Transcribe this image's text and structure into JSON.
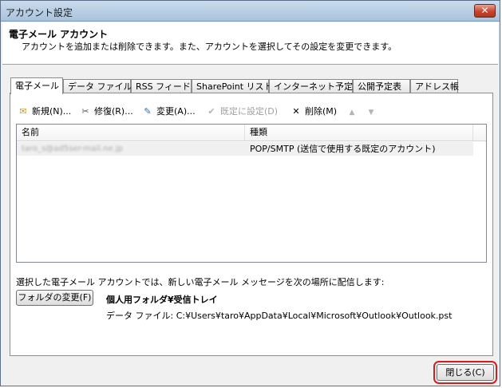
{
  "window": {
    "title": "アカウント設定",
    "close_glyph": "✕"
  },
  "header": {
    "title": "電子メール アカウント",
    "description": "アカウントを追加または削除できます。また、アカウントを選択してその設定を変更できます。"
  },
  "tabs": [
    {
      "label": "電子メール",
      "active": true
    },
    {
      "label": "データ ファイル"
    },
    {
      "label": "RSS フィード"
    },
    {
      "label": "SharePoint リスト"
    },
    {
      "label": "インターネット予定表"
    },
    {
      "label": "公開予定表"
    },
    {
      "label": "アドレス帳"
    }
  ],
  "toolbar": {
    "new_label": "新規(N)...",
    "repair_label": "修復(R)...",
    "change_label": "変更(A)...",
    "default_label": "既定に設定(D)",
    "delete_label": "削除(M)",
    "icons": {
      "new": "✉",
      "repair": "✂",
      "change": "✎",
      "default": "✔",
      "delete": "✕",
      "up": "▲",
      "down": "▼"
    }
  },
  "accounts_table": {
    "columns": [
      "名前",
      "種類"
    ],
    "rows": [
      {
        "name": "taro_s@ad5ser-mail.ne.jp",
        "type": "POP/SMTP (送信で使用する既定のアカウント)"
      }
    ]
  },
  "delivery": {
    "label": "選択した電子メール アカウントでは、新しい電子メール メッセージを次の場所に配信します:",
    "folder_button_label": "フォルダの変更(F)",
    "folder_name": "個人用フォルダ¥受信トレイ",
    "data_file": "データ ファイル: C:¥Users¥taro¥AppData¥Local¥Microsoft¥Outlook¥Outlook.pst"
  },
  "footer": {
    "close_label": "閉じる(C)"
  },
  "colors": {
    "highlight": "#d01f1f"
  }
}
